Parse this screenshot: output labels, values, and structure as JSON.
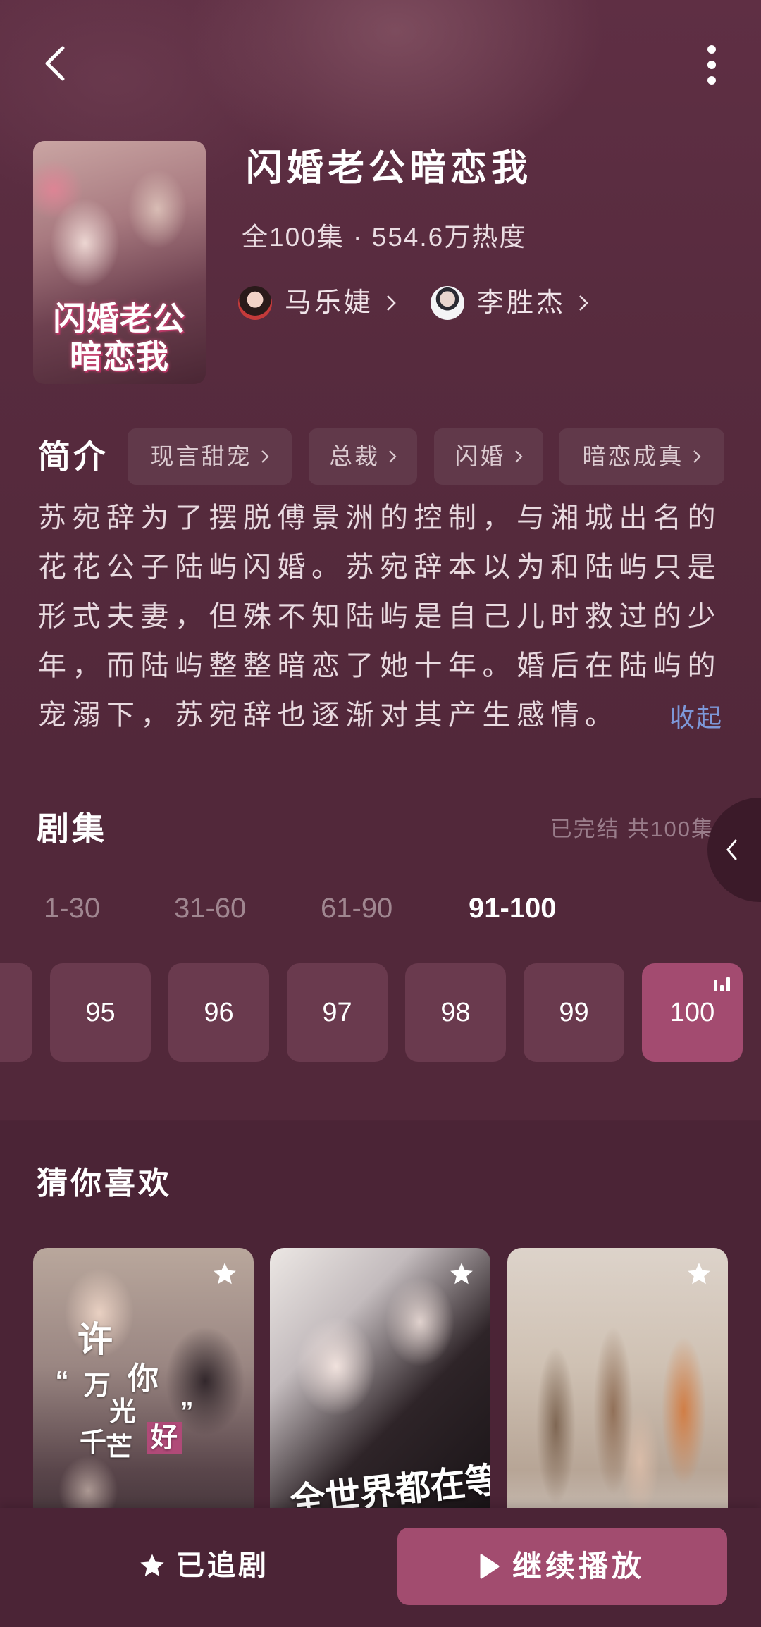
{
  "header": {
    "back_icon": "back-arrow-icon",
    "more_icon": "more-vertical-icon"
  },
  "drama": {
    "poster_lines": [
      "闪婚老公",
      "暗恋我"
    ],
    "title": "闪婚老公暗恋我",
    "meta": "全100集 · 554.6万热度",
    "actors": [
      {
        "name": "马乐婕"
      },
      {
        "name": "李胜杰"
      }
    ]
  },
  "intro": {
    "label": "简介",
    "tags": [
      "现言甜宠",
      "总裁",
      "闪婚",
      "暗恋成真"
    ],
    "description": "苏宛辞为了摆脱傅景洲的控制，与湘城出名的花花公子陆屿闪婚。苏宛辞本以为和陆屿只是形式夫妻，但殊不知陆屿是自己儿时救过的少年，而陆屿整整暗恋了她十年。婚后在陆屿的宠溺下，苏宛辞也逐渐对其产生感情。",
    "collapse_label": "收起"
  },
  "episodes": {
    "label": "剧集",
    "summary": "已完结 共100集",
    "ranges": [
      {
        "label": "1-30",
        "selected": false
      },
      {
        "label": "31-60",
        "selected": false
      },
      {
        "label": "61-90",
        "selected": false
      },
      {
        "label": "91-100",
        "selected": true
      }
    ],
    "items": [
      {
        "num": "95",
        "selected": false
      },
      {
        "num": "96",
        "selected": false
      },
      {
        "num": "97",
        "selected": false
      },
      {
        "num": "98",
        "selected": false
      },
      {
        "num": "99",
        "selected": false
      },
      {
        "num": "100",
        "selected": true
      }
    ],
    "playing_icon": "playing-bars-icon"
  },
  "recommend": {
    "label": "猜你喜欢",
    "cards": [
      {
        "title_chars": [
          "许",
          "“",
          "万",
          "你",
          "光",
          "千",
          "芒",
          "好",
          "”"
        ],
        "star_icon": "star-icon"
      },
      {
        "poster_text": "全世界都在等",
        "star_icon": "star-icon"
      },
      {
        "star_icon": "star-icon"
      }
    ]
  },
  "bottom_bar": {
    "follow_label": "已追剧",
    "play_label": "继续播放"
  },
  "colors": {
    "background": "#52283a",
    "accent": "#a34b70",
    "episode_box": "#6a3a4e",
    "link": "#7d97d8",
    "muted": "#9a7d8b"
  }
}
